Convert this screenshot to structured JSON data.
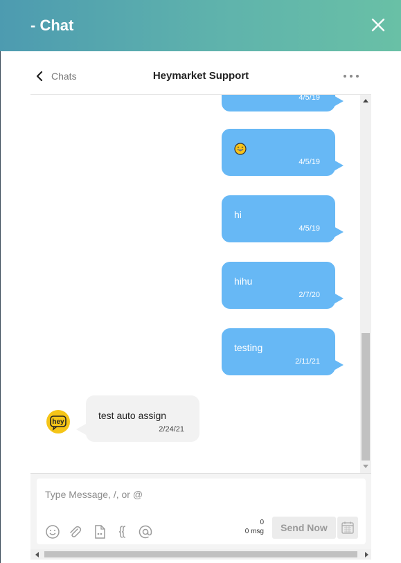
{
  "window": {
    "title": "- Chat",
    "close_icon": "close-icon"
  },
  "conversation": {
    "back_label": "Chats",
    "title": "Heymarket Support",
    "more_icon": "more-horizontal-icon"
  },
  "messages": [
    {
      "direction": "outgoing",
      "text": "",
      "time": "4/5/19",
      "partial": true
    },
    {
      "direction": "outgoing",
      "text": "",
      "emoji": "grinning-face-icon",
      "time": "4/5/19"
    },
    {
      "direction": "outgoing",
      "text": "hi",
      "time": "4/5/19"
    },
    {
      "direction": "outgoing",
      "text": "hihu",
      "time": "2/7/20"
    },
    {
      "direction": "outgoing",
      "text": "testing",
      "time": "2/11/21"
    },
    {
      "direction": "incoming",
      "text": "test auto assign",
      "time": "2/24/21",
      "avatar": "hey",
      "avatar_color": "#f5c518"
    }
  ],
  "composer": {
    "placeholder": "Type Message, /, or @",
    "value": "",
    "char_count": "0",
    "msg_count": "0 msg",
    "send_label": "Send Now",
    "tools": [
      "emoji-icon",
      "attachment-icon",
      "template-icon",
      "merge-field-icon",
      "mention-icon"
    ]
  },
  "colors": {
    "header_start": "#4d9bb0",
    "header_end": "#69c0a6",
    "outgoing_bubble": "#67b8f5",
    "incoming_bubble": "#f2f2f2",
    "avatar": "#f5c518"
  }
}
